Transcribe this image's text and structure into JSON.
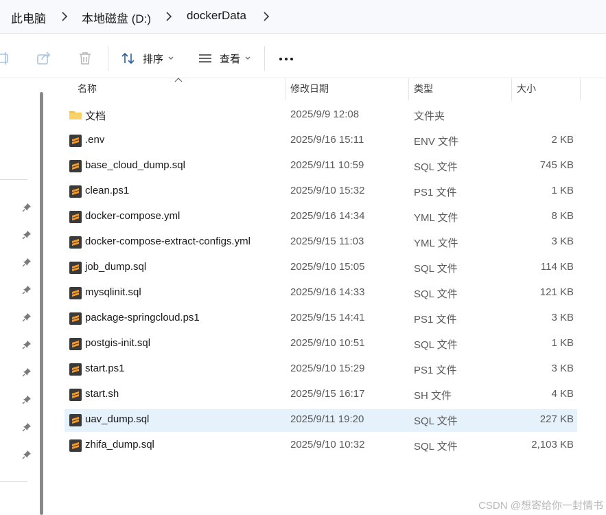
{
  "breadcrumb": {
    "items": [
      "此电脑",
      "本地磁盘 (D:)",
      "dockerData"
    ]
  },
  "toolbar": {
    "sort_label": "排序",
    "view_label": "查看",
    "more_label": "•••"
  },
  "columns": {
    "name": "名称",
    "modified": "修改日期",
    "type": "类型",
    "size": "大小"
  },
  "files": [
    {
      "name": "文档",
      "modified": "2025/9/9 12:08",
      "type": "文件夹",
      "size": "",
      "icon": "folder-icon"
    },
    {
      "name": ".env",
      "modified": "2025/9/16 15:11",
      "type": "ENV 文件",
      "size": "2 KB",
      "icon": "sublime-file-icon"
    },
    {
      "name": "base_cloud_dump.sql",
      "modified": "2025/9/11 10:59",
      "type": "SQL 文件",
      "size": "745 KB",
      "icon": "sublime-file-icon"
    },
    {
      "name": "clean.ps1",
      "modified": "2025/9/10 15:32",
      "type": "PS1 文件",
      "size": "1 KB",
      "icon": "sublime-file-icon"
    },
    {
      "name": "docker-compose.yml",
      "modified": "2025/9/16 14:34",
      "type": "YML 文件",
      "size": "8 KB",
      "icon": "sublime-file-icon"
    },
    {
      "name": "docker-compose-extract-configs.yml",
      "modified": "2025/9/15 11:03",
      "type": "YML 文件",
      "size": "3 KB",
      "icon": "sublime-file-icon"
    },
    {
      "name": "job_dump.sql",
      "modified": "2025/9/10 15:05",
      "type": "SQL 文件",
      "size": "114 KB",
      "icon": "sublime-file-icon"
    },
    {
      "name": "mysqlinit.sql",
      "modified": "2025/9/16 14:33",
      "type": "SQL 文件",
      "size": "121 KB",
      "icon": "sublime-file-icon"
    },
    {
      "name": "package-springcloud.ps1",
      "modified": "2025/9/15 14:41",
      "type": "PS1 文件",
      "size": "3 KB",
      "icon": "sublime-file-icon"
    },
    {
      "name": "postgis-init.sql",
      "modified": "2025/9/10 10:51",
      "type": "SQL 文件",
      "size": "1 KB",
      "icon": "sublime-file-icon"
    },
    {
      "name": "start.ps1",
      "modified": "2025/9/10 15:29",
      "type": "PS1 文件",
      "size": "3 KB",
      "icon": "sublime-file-icon"
    },
    {
      "name": "start.sh",
      "modified": "2025/9/15 16:17",
      "type": "SH 文件",
      "size": "4 KB",
      "icon": "sublime-file-icon"
    },
    {
      "name": "uav_dump.sql",
      "modified": "2025/9/11 19:20",
      "type": "SQL 文件",
      "size": "227 KB",
      "icon": "sublime-file-icon",
      "selected": true
    },
    {
      "name": "zhifa_dump.sql",
      "modified": "2025/9/10 10:32",
      "type": "SQL 文件",
      "size": "2,103 KB",
      "icon": "sublime-file-icon"
    }
  ],
  "watermark": "CSDN @想寄给你一封情书",
  "colors": {
    "selected_row": "#e5f1fb",
    "folder": "#f2c14e",
    "sublime_bg": "#3a3a3a",
    "sublime_s": "#f89820"
  }
}
